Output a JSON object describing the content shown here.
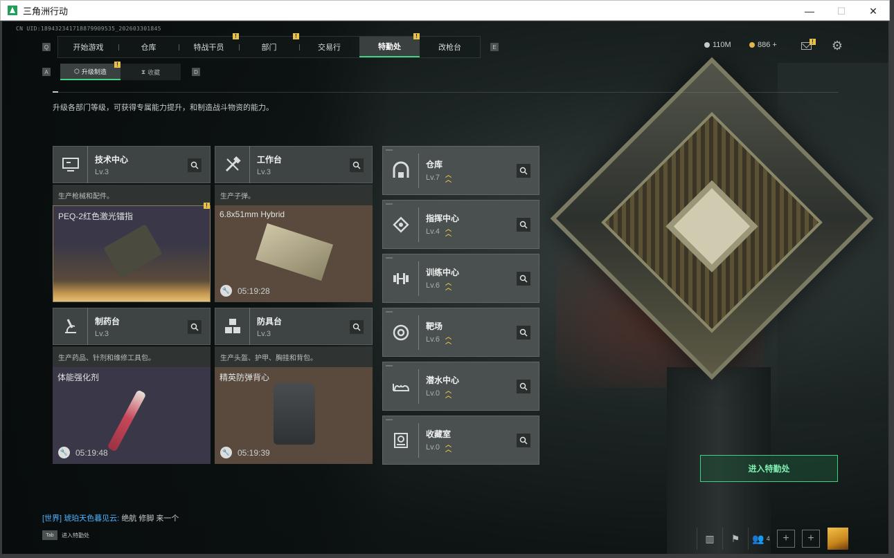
{
  "window": {
    "title": "三角洲行动",
    "minimize": "—",
    "maximize": "☐",
    "close": "✕"
  },
  "uid": "CN UID:18943234171887990953​5_202603301845",
  "nav": {
    "key_left": "Q",
    "key_right": "E",
    "tabs": [
      {
        "label": "开始游戏",
        "badge": ""
      },
      {
        "label": "仓库",
        "badge": ""
      },
      {
        "label": "特战干员",
        "badge": "!"
      },
      {
        "label": "部门",
        "badge": "!"
      },
      {
        "label": "交易行",
        "badge": ""
      },
      {
        "label": "特勤处",
        "badge": "!",
        "active": true
      },
      {
        "label": "改枪台",
        "badge": ""
      }
    ]
  },
  "currency": {
    "silver": "110M",
    "gold": "886 +",
    "silver_color": "#c5c9c8",
    "gold_color": "#e3b54a"
  },
  "subnav": {
    "key_left": "A",
    "key_right": "D",
    "upgrade": "升级制造",
    "collect": "收藏",
    "upgrade_badge": "!"
  },
  "description": "升级各部门等级，可获得专属能力提升，和制造战斗物资的能力。",
  "left_cards": [
    {
      "name": "技术中心",
      "level": "Lv.3",
      "desc": "生产枪械和配件。",
      "item": "PEQ-2红色激光镭指",
      "timer": "",
      "badge": "!"
    },
    {
      "name": "工作台",
      "level": "Lv.3",
      "desc": "生产子弹。",
      "item": "6.8x51mm Hybrid",
      "timer": "05:19:28",
      "badge": ""
    },
    {
      "name": "制药台",
      "level": "Lv.3",
      "desc": "生产药品、针剂和维修工具包。",
      "item": "体能强化剂",
      "timer": "05:19:48",
      "badge": ""
    },
    {
      "name": "防具台",
      "level": "Lv.3",
      "desc": "生产头盔、护甲、胸挂和背包。",
      "item": "精英防弹背心",
      "timer": "05:19:39",
      "badge": ""
    }
  ],
  "right_cards": [
    {
      "name": "仓库",
      "level": "Lv.7"
    },
    {
      "name": "指挥中心",
      "level": "Lv.4"
    },
    {
      "name": "训练中心",
      "level": "Lv.6"
    },
    {
      "name": "靶场",
      "level": "Lv.6"
    },
    {
      "name": "潜水中心",
      "level": "Lv.0"
    },
    {
      "name": "收藏室",
      "level": "Lv.0"
    }
  ],
  "enter_button": "进入特勤处",
  "chat": {
    "channel": "[世界]",
    "user": "琥珀天色暮见云:",
    "message": "绝航 修脚 来一个"
  },
  "tab_hint": {
    "key": "Tab",
    "label": "进入特勤处"
  },
  "bottom": {
    "team_count": "4"
  },
  "colors": {
    "accent": "#3fd484",
    "badge": "#e7c24a"
  }
}
